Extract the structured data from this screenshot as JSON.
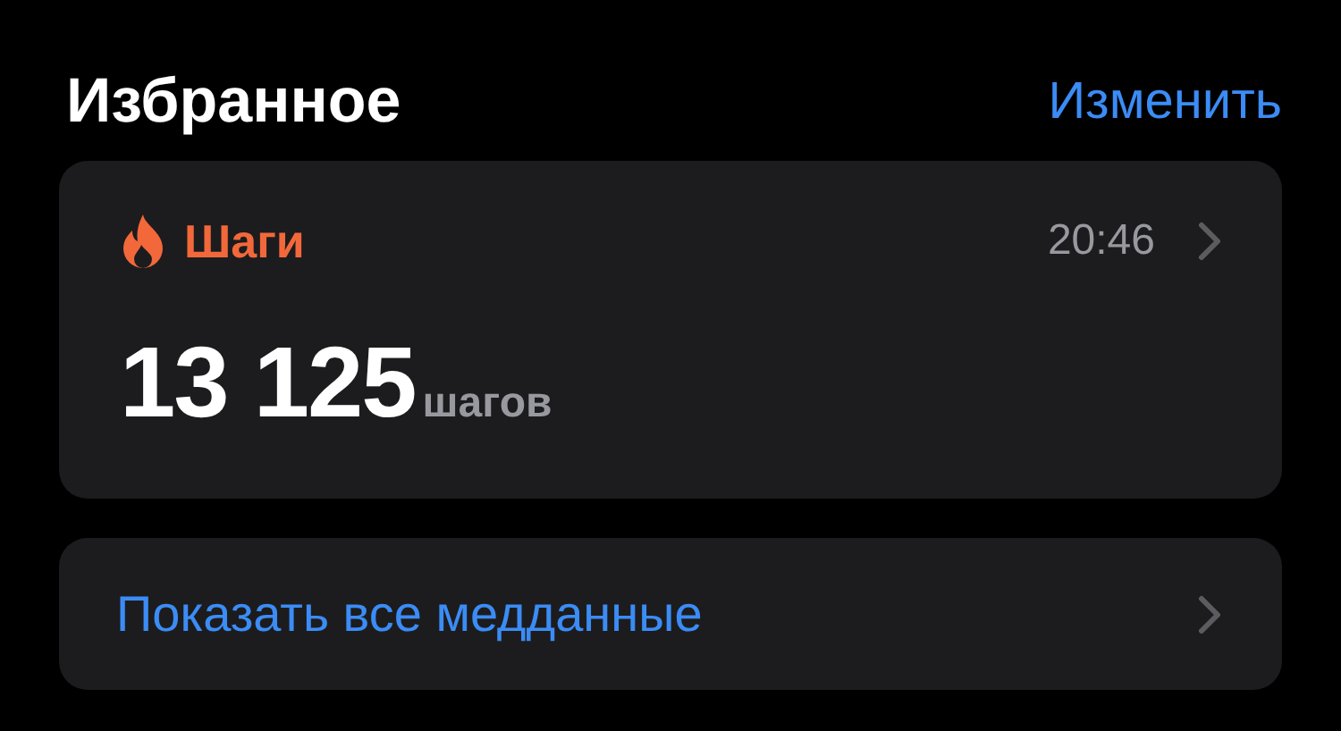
{
  "header": {
    "title": "Избранное",
    "edit_link": "Изменить"
  },
  "favorites": [
    {
      "category": "Шаги",
      "color": "#f2683a",
      "time": "20:46",
      "value": "13 125",
      "unit": "шагов"
    }
  ],
  "show_all": {
    "label": "Показать все медданные"
  }
}
